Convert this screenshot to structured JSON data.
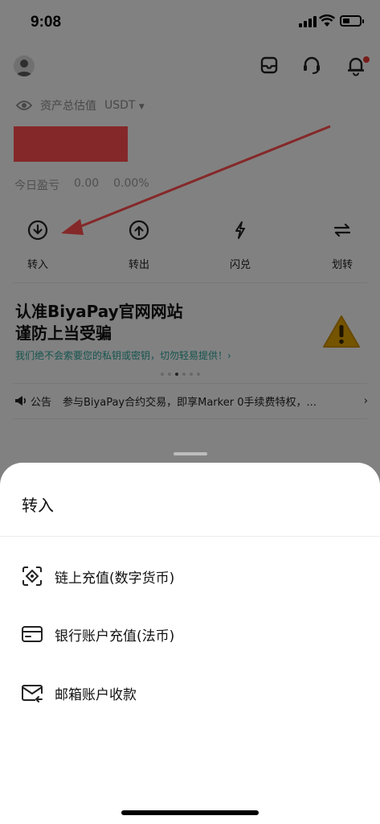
{
  "status_bar": {
    "time": "9:08"
  },
  "header": {
    "icons": [
      "avatar",
      "mailbox-icon",
      "headset-icon",
      "bell-icon"
    ]
  },
  "assets": {
    "label": "资产总估值",
    "currency": "USDT",
    "pnl_label": "今日盈亏",
    "pnl_value": "0.00",
    "pnl_percent": "0.00%"
  },
  "actions": [
    {
      "label": "转入",
      "icon": "download-icon"
    },
    {
      "label": "转出",
      "icon": "upload-icon"
    },
    {
      "label": "闪兑",
      "icon": "lightning-icon"
    },
    {
      "label": "划转",
      "icon": "swap-icon"
    }
  ],
  "promo": {
    "title_line1": "认准BiyaPay官网网站",
    "title_line2": "谨防上当受骗",
    "subtitle": "我们绝不会索要您的私钥或密钥，切勿轻易提供！›"
  },
  "notice": {
    "label": "公告",
    "text": "参与BiyaPay合约交易，即享Marker 0手续费特权，...",
    "chevron": "›"
  },
  "sheet": {
    "title": "转入",
    "options": [
      {
        "label": "链上充值(数字货币)",
        "icon": "scan-coin-icon"
      },
      {
        "label": "银行账户充值(法币)",
        "icon": "bank-card-icon"
      },
      {
        "label": "邮箱账户收款",
        "icon": "mail-receive-icon"
      }
    ]
  },
  "colors": {
    "accent_red": "#ff4d4f",
    "promo_teal": "#2aa39a",
    "overlay": "rgba(0,0,0,0.48)"
  }
}
